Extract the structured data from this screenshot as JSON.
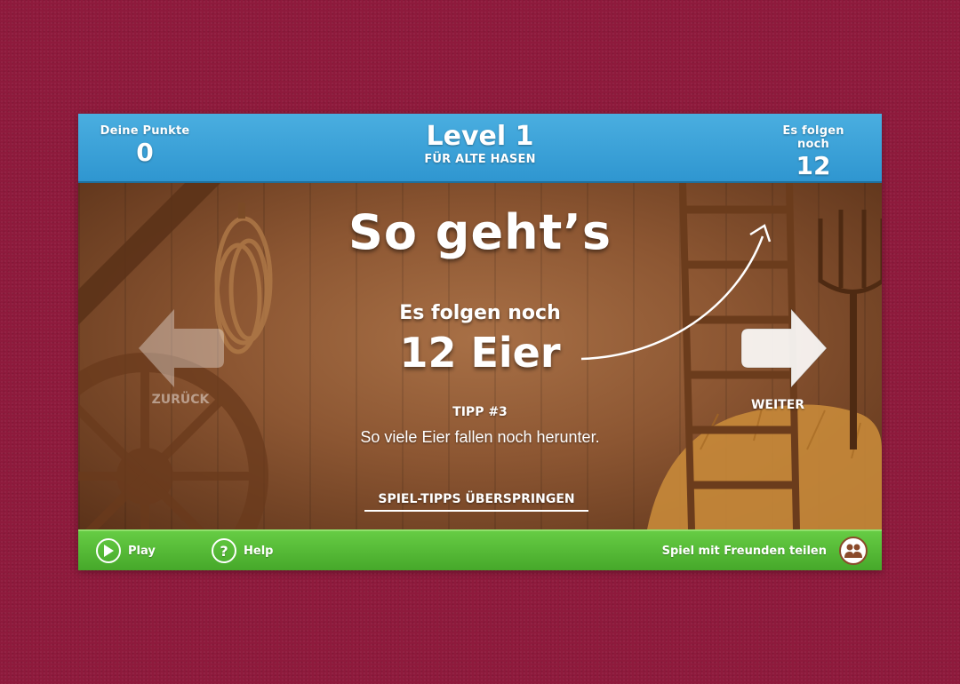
{
  "header": {
    "score_label": "Deine Punkte",
    "score_value": "0",
    "level_title": "Level 1",
    "level_subtitle": "FÜR ALTE HASEN",
    "remaining_label": "Es folgen noch",
    "remaining_value": "12 Eier"
  },
  "tutorial": {
    "title": "So geht’s",
    "eggs_label": "Es folgen noch",
    "eggs_value": "12 Eier",
    "tip_number": "TIPP #3",
    "tip_text": "So viele Eier fallen noch herunter.",
    "skip_label": "SPIEL-TIPPS ÜBERSPRINGEN",
    "prev_label": "ZURÜCK",
    "next_label": "WEITER"
  },
  "footer": {
    "play_label": "Play",
    "help_label": "Help",
    "share_label": "Spiel mit Freunden teilen"
  },
  "colors": {
    "page_background": "#8e1a3c",
    "topbar": "#2f96d0",
    "bottombar": "#46a82a",
    "wood": "#8c5632"
  },
  "icons": {
    "play": "play-icon",
    "help": "help-icon",
    "share": "friends-icon",
    "prev": "arrow-left-icon",
    "next": "arrow-right-icon"
  }
}
